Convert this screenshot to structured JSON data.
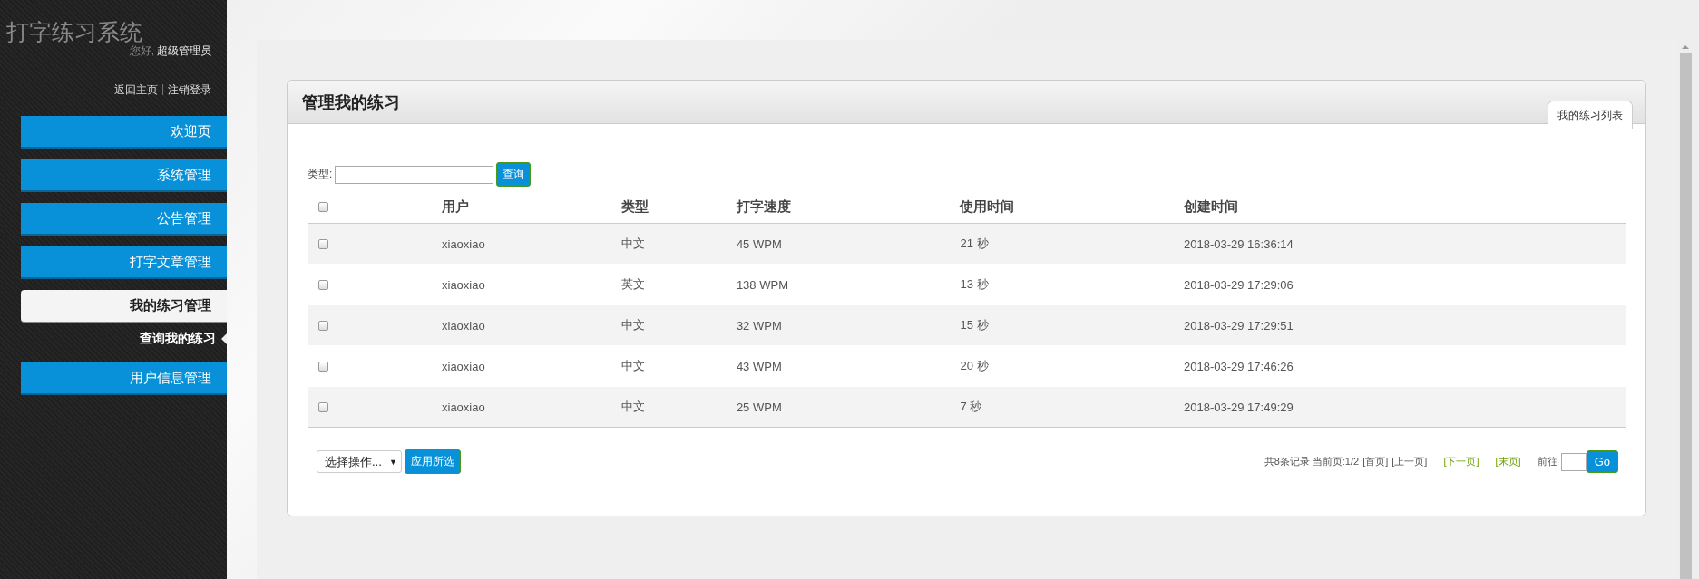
{
  "app": {
    "title": "打字练习系统",
    "greeting": "您好,",
    "user": "超级管理员",
    "links": [
      "返回主页",
      "注销登录"
    ],
    "separator": "|"
  },
  "menu": [
    {
      "label": "欢迎页",
      "selected": false
    },
    {
      "label": "系统管理",
      "selected": false
    },
    {
      "label": "公告管理",
      "selected": false
    },
    {
      "label": "打字文章管理",
      "selected": false
    },
    {
      "label": "我的练习管理",
      "selected": true,
      "children": [
        {
          "label": "查询我的练习",
          "selected": true
        }
      ]
    },
    {
      "label": "用户信息管理",
      "selected": false
    }
  ],
  "panel": {
    "title": "管理我的练习",
    "tabs": [
      {
        "label": "我的练习列表",
        "selected": true
      }
    ]
  },
  "filter": {
    "label": "类型:",
    "button": "查询"
  },
  "table": {
    "select_all": {
      "checked": false
    },
    "columns": [
      "用户",
      "类型",
      "打字速度",
      "使用时间",
      "创建时间"
    ],
    "rows": [
      {
        "checked": false,
        "cells": [
          "xiaoxiao",
          "中文",
          "45 WPM",
          "21 秒",
          "2018-03-29 16:36:14"
        ]
      },
      {
        "checked": false,
        "cells": [
          "xiaoxiao",
          "英文",
          "138 WPM",
          "13 秒",
          "2018-03-29 17:29:06"
        ]
      },
      {
        "checked": false,
        "cells": [
          "xiaoxiao",
          "中文",
          "32 WPM",
          "15 秒",
          "2018-03-29 17:29:51"
        ]
      },
      {
        "checked": false,
        "cells": [
          "xiaoxiao",
          "中文",
          "43 WPM",
          "20 秒",
          "2018-03-29 17:46:26"
        ]
      },
      {
        "checked": false,
        "cells": [
          "xiaoxiao",
          "中文",
          "25 WPM",
          "7 秒",
          "2018-03-29 17:49:29"
        ]
      }
    ]
  },
  "bulk": {
    "select": "选择操作...",
    "caret": "▼",
    "button": "应用所选"
  },
  "pagination": {
    "summary": "共8条记录 当前页:1/2",
    "links": [
      {
        "label": "[首页]",
        "disabled": true
      },
      {
        "label": "[上一页]",
        "disabled": true
      },
      {
        "label": "[下一页]",
        "disabled": false
      },
      {
        "label": "[末页]",
        "disabled": false
      }
    ],
    "goto_label": "前往",
    "go_button": "Go"
  }
}
